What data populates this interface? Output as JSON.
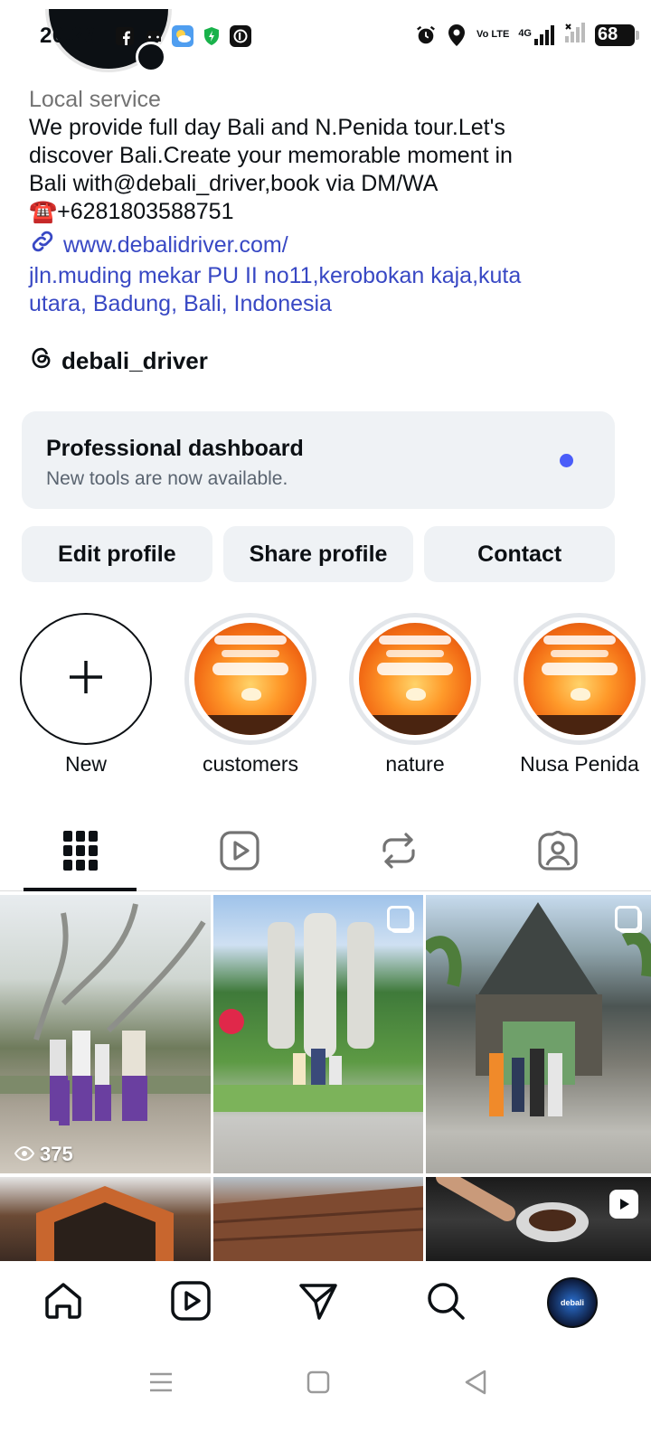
{
  "status_bar": {
    "time": "20.26",
    "left_icons": [
      "facebook-icon",
      "car-icon",
      "weather-icon",
      "shield-icon",
      "d-app-icon"
    ],
    "volte": "Vo LTE",
    "network": "4G",
    "battery": "68"
  },
  "profile": {
    "category": "Local service",
    "bio_lines": [
      "We provide full day Bali and N.Penida tour.Let's",
      "discover Bali.Create your memorable moment in",
      "Bali with@debali_driver,book via DM/WA",
      "☎️+6281803588751"
    ],
    "link": "www.debalidriver.com/",
    "address_lines": [
      "jln.muding mekar PU II no11,kerobokan kaja,kuta",
      "utara, Badung, Bali, Indonesia"
    ],
    "threads_handle": "debali_driver"
  },
  "dashboard": {
    "title": "Professional dashboard",
    "subtitle": "New tools are now available."
  },
  "actions": {
    "edit": "Edit profile",
    "share": "Share profile",
    "contact": "Contact"
  },
  "highlights": [
    {
      "label": "New"
    },
    {
      "label": "customers"
    },
    {
      "label": "nature"
    },
    {
      "label": "Nusa Penida"
    }
  ],
  "tabs": [
    "grid-icon",
    "reels-icon",
    "reposts-icon",
    "tagged-icon"
  ],
  "posts": [
    {
      "views": "375"
    }
  ],
  "bottom_nav": {
    "avatar_text": "debali"
  },
  "colors": {
    "link": "#3848c4",
    "dashboard_bg": "#eff2f5",
    "dot": "#4a5df9"
  }
}
